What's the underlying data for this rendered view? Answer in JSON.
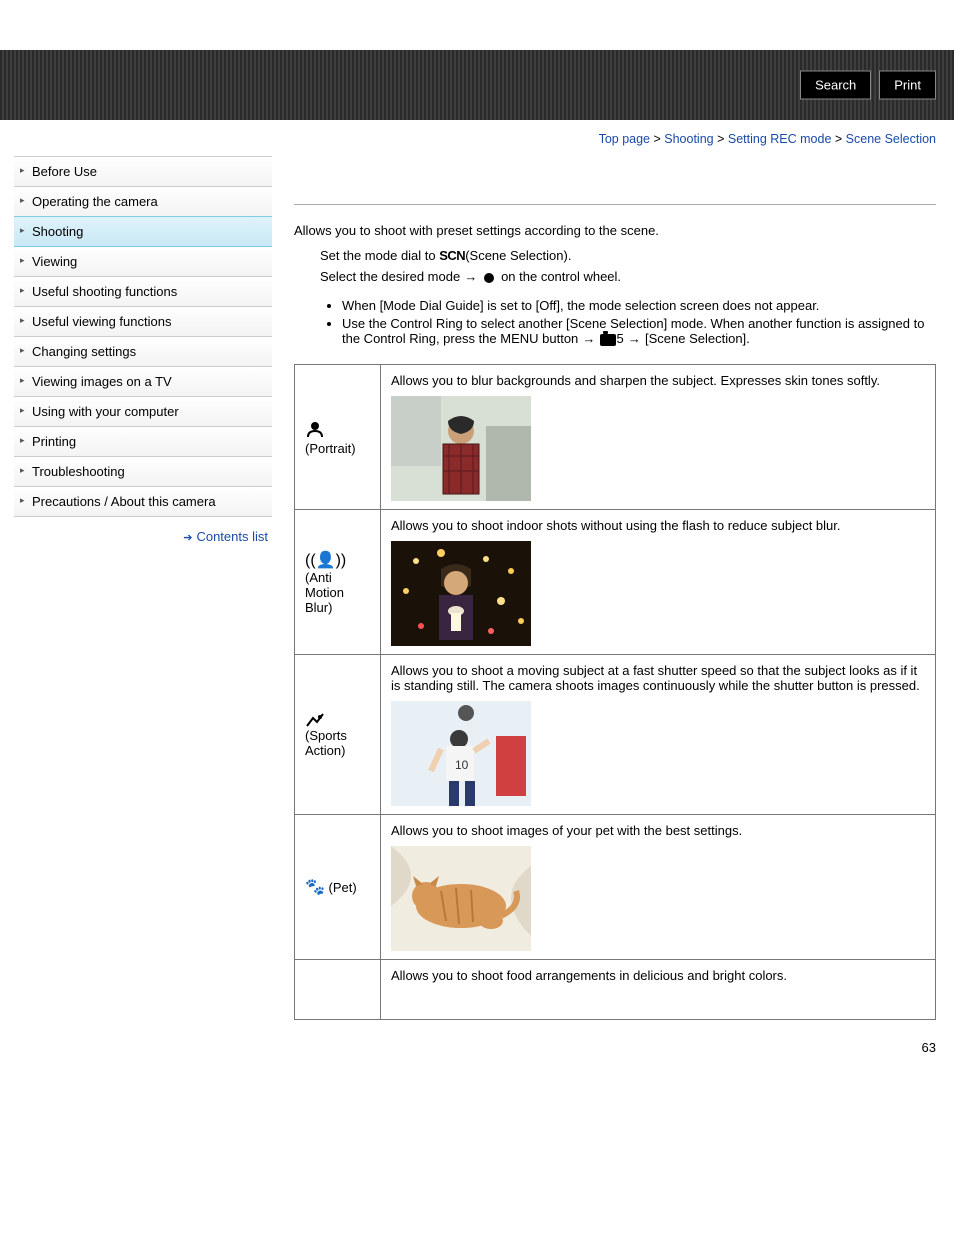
{
  "header": {
    "search_label": "Search",
    "print_label": "Print"
  },
  "breadcrumb": {
    "items": [
      "Top page",
      "Shooting",
      "Setting REC mode"
    ],
    "current": "Scene Selection",
    "sep": " > "
  },
  "sidebar": {
    "items": [
      {
        "label": "Before Use",
        "active": false
      },
      {
        "label": "Operating the camera",
        "active": false
      },
      {
        "label": "Shooting",
        "active": true
      },
      {
        "label": "Viewing",
        "active": false
      },
      {
        "label": "Useful shooting functions",
        "active": false
      },
      {
        "label": "Useful viewing functions",
        "active": false
      },
      {
        "label": "Changing settings",
        "active": false
      },
      {
        "label": "Viewing images on a TV",
        "active": false
      },
      {
        "label": "Using with your computer",
        "active": false
      },
      {
        "label": "Printing",
        "active": false
      },
      {
        "label": "Troubleshooting",
        "active": false
      },
      {
        "label": "Precautions / About this camera",
        "active": false
      }
    ],
    "contents_list_label": "Contents list"
  },
  "content": {
    "intro": "Allows you to shoot with preset settings according to the scene.",
    "step1_pre": "Set the mode dial to ",
    "step1_scn": "SCN",
    "step1_post": "(Scene Selection).",
    "step2_pre": "Select the desired mode ",
    "step2_post": " on the control wheel.",
    "bullet1": "When [Mode Dial Guide] is set to [Off], the mode selection screen does not appear.",
    "bullet2_pre": "Use the Control Ring to select another [Scene Selection] mode. When another function is assigned to the Control Ring, press the MENU button ",
    "bullet2_cam_suffix": "5",
    "bullet2_post": " [Scene Selection]."
  },
  "scenes": [
    {
      "icon": "head",
      "name": "(Portrait)",
      "desc": "Allows you to blur backgrounds and sharpen the subject. Expresses skin tones softly."
    },
    {
      "icon": "blur",
      "name": " (Anti Motion Blur)",
      "desc": "Allows you to shoot indoor shots without using the flash to reduce subject blur."
    },
    {
      "icon": "sports",
      "name": " (Sports Action)",
      "desc": "Allows you to shoot a moving subject at a fast shutter speed so that the subject looks as if it is standing still. The camera shoots images continuously while the shutter button is pressed."
    },
    {
      "icon": "pet",
      "name": " (Pet)",
      "desc": "Allows you to shoot images of your pet with the best settings."
    },
    {
      "icon": "",
      "name": "",
      "desc": "Allows you to shoot food arrangements in delicious and bright colors."
    }
  ],
  "page_number": "63"
}
